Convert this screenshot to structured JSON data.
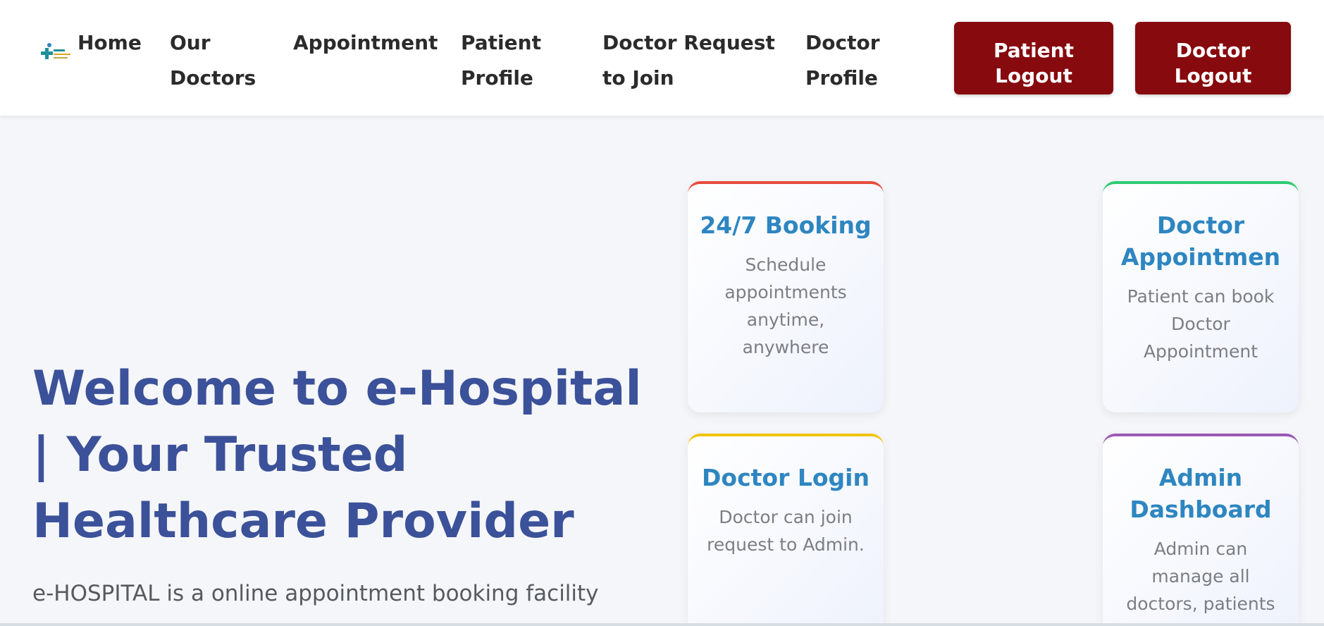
{
  "nav": {
    "links": [
      {
        "label": "Home"
      },
      {
        "label": "Our Doctors"
      },
      {
        "label": "Appointment"
      },
      {
        "label": "Patient Profile"
      },
      {
        "label": "Doctor Request to Join"
      },
      {
        "label": "Doctor Profile"
      }
    ],
    "buttons": {
      "patient_logout": "Patient Logout",
      "doctor_logout": "Doctor Logout"
    },
    "button_color": "#870a0e"
  },
  "hero": {
    "title": "Welcome to e-Hospital | Your Trusted Healthcare Provider",
    "description": "e-HOSPITAL is a online appointment booking facility",
    "title_color": "#3b5199"
  },
  "features": [
    {
      "title": "24/7 Booking",
      "description": "Schedule appointments anytime, anywhere",
      "accent": "#e74c3c"
    },
    {
      "title": "Doctor Appointmen",
      "description": "Patient can book Doctor Appointment",
      "accent": "#2ecc71"
    },
    {
      "title": "Doctor Login",
      "description": "Doctor can join request to Admin.",
      "accent": "#f1c40f"
    },
    {
      "title": "Admin Dashboard",
      "description": "Admin can manage all doctors, patients",
      "accent": "#9b59b6"
    }
  ]
}
